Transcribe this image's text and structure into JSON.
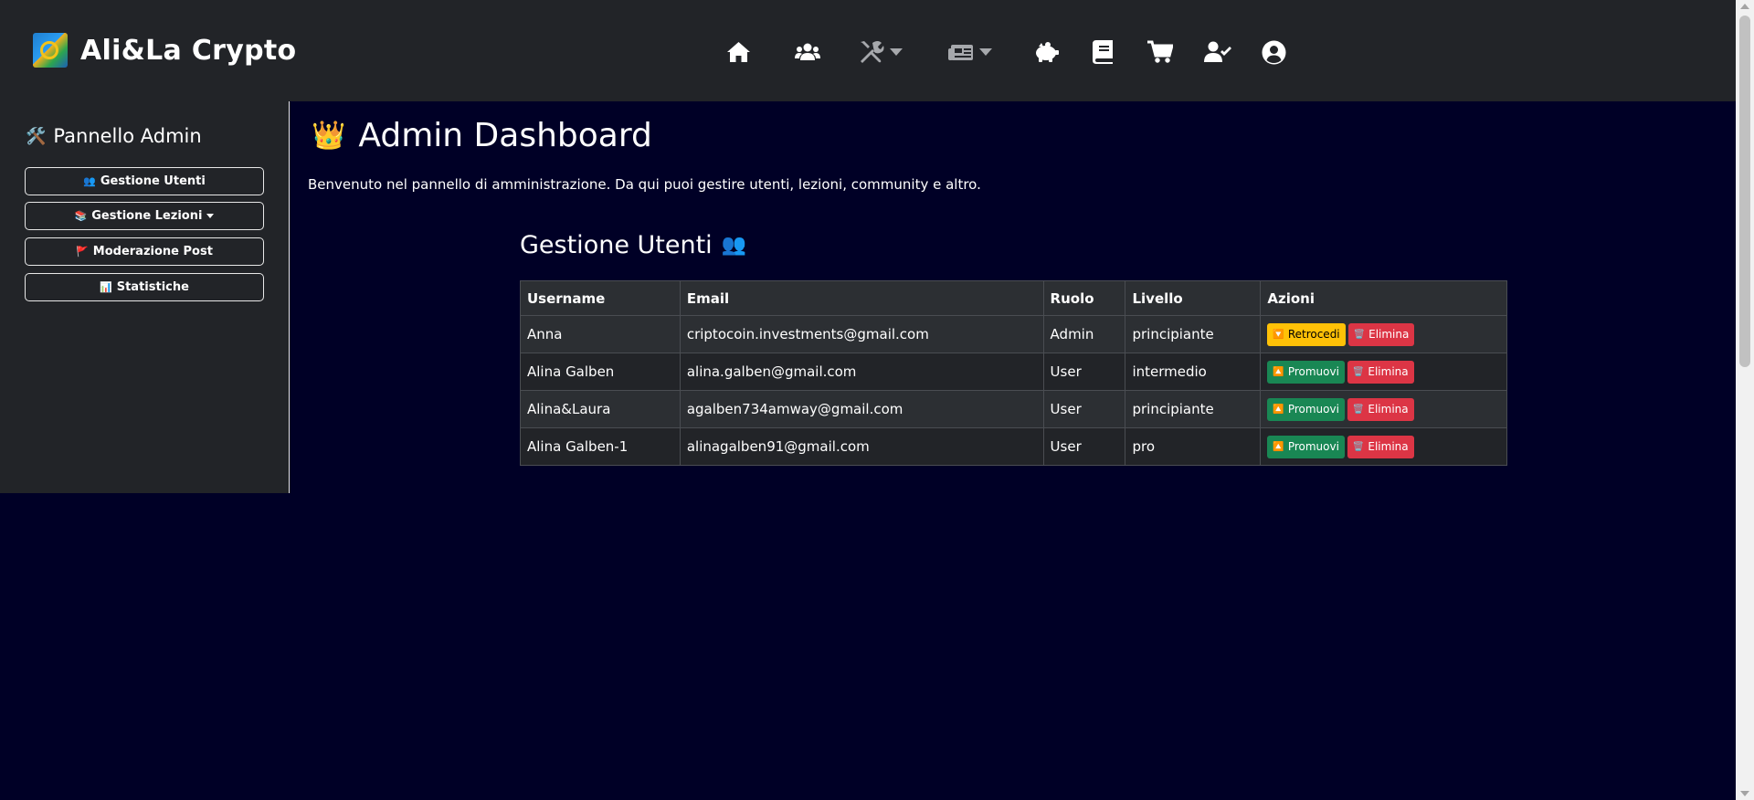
{
  "brand": {
    "name": "Ali&La Crypto"
  },
  "nav": {
    "icons": [
      "home-icon",
      "users-icon",
      "tools-icon",
      "newspaper-icon",
      "piggy-bank-icon",
      "book-icon",
      "cart-icon",
      "user-check-icon",
      "user-circle-icon"
    ]
  },
  "sidebar": {
    "title": "Pannello Admin",
    "title_icon": "🛠️",
    "items": [
      {
        "label": "Gestione Utenti",
        "icon": "👥"
      },
      {
        "label": "Gestione Lezioni",
        "icon": "📚"
      },
      {
        "label": "Moderazione Post",
        "icon": "🚩"
      },
      {
        "label": "Statistiche",
        "icon": "📊"
      }
    ]
  },
  "main": {
    "title": "Admin Dashboard",
    "title_icon": "👑",
    "welcome": "Benvenuto nel pannello di amministrazione. Da qui puoi gestire utenti, lezioni, community e altro.",
    "section_title": "Gestione Utenti",
    "section_icon": "👥"
  },
  "table": {
    "headers": [
      "Username",
      "Email",
      "Ruolo",
      "Livello",
      "Azioni"
    ],
    "rows": [
      {
        "username": "Anna",
        "email": "criptocoin.investments@gmail.com",
        "ruolo": "Admin",
        "livello": "principiante",
        "primary_action": "Retrocedi",
        "primary_icon": "🔽",
        "delete": "Elimina",
        "delete_icon": "🗑️"
      },
      {
        "username": "Alina Galben",
        "email": "alina.galben@gmail.com",
        "ruolo": "User",
        "livello": "intermedio",
        "primary_action": "Promuovi",
        "primary_icon": "🔼",
        "delete": "Elimina",
        "delete_icon": "🗑️"
      },
      {
        "username": "Alina&Laura",
        "email": "agalben734amway@gmail.com",
        "ruolo": "User",
        "livello": "principiante",
        "primary_action": "Promuovi",
        "primary_icon": "🔼",
        "delete": "Elimina",
        "delete_icon": "🗑️"
      },
      {
        "username": "Alina Galben-1",
        "email": "alinagalben91@gmail.com",
        "ruolo": "User",
        "livello": "pro",
        "primary_action": "Promuovi",
        "primary_icon": "🔼",
        "delete": "Elimina",
        "delete_icon": "🗑️"
      }
    ]
  },
  "colors": {
    "page_bg": "#000026",
    "panel_bg": "#222428",
    "warning": "#ffc107",
    "success": "#198754",
    "danger": "#dc3545"
  }
}
